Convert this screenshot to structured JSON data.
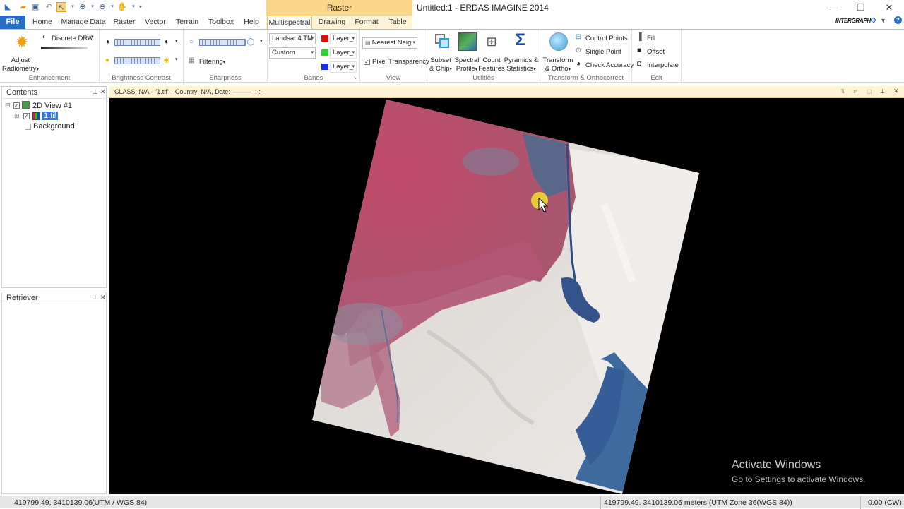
{
  "window": {
    "title": "Untitled:1 - ERDAS IMAGINE 2014",
    "context_tab": "Raster"
  },
  "tabs": [
    "File",
    "Home",
    "Manage Data",
    "Raster",
    "Vector",
    "Terrain",
    "Toolbox",
    "Help",
    "Multispectral",
    "Drawing",
    "Format",
    "Table"
  ],
  "brand": "INTERGRAPH",
  "ribbon": {
    "enhancement": {
      "dra": "Discrete DRA",
      "adjust1": "Adjust",
      "adjust2": "Radiometry",
      "label": "Enhancement"
    },
    "brightness": {
      "label": "Brightness Contrast"
    },
    "sharpness": {
      "filtering": "Filtering",
      "label": "Sharpness"
    },
    "bands": {
      "sensor": "Landsat 4 TM",
      "custom": "Custom",
      "layer_r": "Layer_",
      "layer_g": "Layer_",
      "layer_b": "Layer_",
      "label": "Bands",
      "color_r": "#e01010",
      "color_g": "#2fd12f",
      "color_b": "#1a2fe0"
    },
    "view": {
      "resample": "Nearest Neig",
      "pixel_transparency": "Pixel Transparency",
      "label": "View"
    },
    "utilities": {
      "subset1": "Subset",
      "subset2": "& Chip",
      "spectral1": "Spectral",
      "spectral2": "Profile",
      "count1": "Count",
      "count2": "Features",
      "pyramids1": "Pyramids &",
      "pyramids2": "Statistics",
      "label": "Utilities"
    },
    "transform": {
      "t1": "Transform",
      "t2": "& Ortho",
      "control_points": "Control Points",
      "single_point": "Single Point",
      "check_accuracy": "Check Accuracy",
      "label": "Transform & Orthocorrect"
    },
    "edit": {
      "fill": "Fill",
      "offset": "Offset",
      "interpolate": "Interpolate",
      "label": "Edit"
    }
  },
  "contents": {
    "title": "Contents",
    "view": "2D View #1",
    "layer": "1.tif",
    "background": "Background"
  },
  "retriever": {
    "title": "Retriever"
  },
  "view_header": "CLASS: N/A - \"1.tif\" - Country: N/A, Date: ——— -:-:-",
  "watermark": {
    "line1": "Activate Windows",
    "line2": "Go to Settings to activate Windows."
  },
  "status": {
    "left_coords": "419799.49, 3410139.06",
    "left_crs": "(UTM / WGS 84)",
    "right_coords": "419799.49, 3410139.06 meters (UTM Zone 36(WGS 84))",
    "rotation": "0.00 (CW)"
  }
}
